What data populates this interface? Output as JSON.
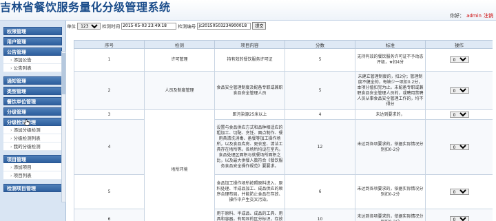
{
  "header": {
    "title": "吉林省餐饮服务量化分级管理系统",
    "user_label": "你好：",
    "username": "admin",
    "logout": "注销"
  },
  "sidebar": {
    "sections": [
      {
        "label": "权限管理",
        "items": []
      },
      {
        "label": "用户管理",
        "items": []
      },
      {
        "label": "公告管理",
        "items": [
          "添加公告",
          "公告列表"
        ]
      },
      {
        "label": "通知管理",
        "items": []
      },
      {
        "label": "类型管理",
        "items": []
      },
      {
        "label": "餐饮单位管理",
        "items": []
      },
      {
        "label": "分级管理",
        "items": []
      },
      {
        "label": "分级检测管理",
        "items": [
          "添加分级检测",
          "分级检测列表",
          "我的分级检测"
        ]
      },
      {
        "label": "项目管理",
        "items": [
          "添加项目",
          "项目列表"
        ]
      },
      {
        "label": "检测项目管理",
        "items": []
      }
    ]
  },
  "filter": {
    "unit_label": "单位",
    "unit_value": "123",
    "time_label": "检测时间",
    "time_value": "2015-05-03 23:49:18",
    "code_label": "检测编号",
    "code_value": "jc20150503234900018",
    "submit": "提交"
  },
  "table": {
    "headers": [
      "序号",
      "检测",
      "项目内容",
      "分数",
      "标准",
      "操作"
    ],
    "rows": [
      {
        "no": "1",
        "check": "许可管理",
        "content": "持有效的餐饮服务许可证",
        "score": "5",
        "standard": "无持有效的餐饮服务许可证不予动态评级，★扣4分",
        "op": "0"
      },
      {
        "no": "2",
        "check": "人员及制度管理",
        "content": "食品安全管理制度及配备专职或兼职食品安全管理人员",
        "score": "5",
        "standard": "未建立管理制度的，扣2分；管理制度不健全的，每缺少一项扣0.2分，本项分值扣完为止。未配备专职或兼职食品安全管理人员的，或聘用禁聘人员从事食品安全管理工作的，均不得分",
        "op": "0"
      },
      {
        "no": "3",
        "check": "",
        "content": "距污染源25米以上",
        "score": "4",
        "standard": "未达到要求的，",
        "op": "0"
      },
      {
        "no": "4",
        "check": "场所环境",
        "content": "设置与食品供应方式和品种相适应的粗加工、切配、烹饪、面点制作、餐用具清洗消毒、备餐等加工操作场所，以及食品库房、更衣室、清洁工具存在场所等。各场所均设在室内。食品处理区面积与就餐场所面积之比，以及最大供餐人数符合《餐饮服务食品安全操作规范》要要求。",
        "score": "12",
        "standard": "未达到各项要求的，依据实际情况分别扣0-2分",
        "op": "0"
      },
      {
        "no": "5",
        "check": "",
        "content": "食品加工操作场所按照原料进入、原料处理、半成品加工、成品供应的顺序合理布局，并能防止食品在存放、操作中产生交叉污染。",
        "score": "6",
        "standard": "未达到各项要求的，依据实际情况分别扣0-2分",
        "op": "0"
      },
      {
        "no": "6",
        "check": "",
        "content": "用于原料、半成品、成品的工具、用具和容器，有明显的区分标识，存放区域分开设置。",
        "score": "10",
        "standard": "未达到各项要求的，依据实际情况分别扣0-2分",
        "op": "0"
      }
    ]
  }
}
